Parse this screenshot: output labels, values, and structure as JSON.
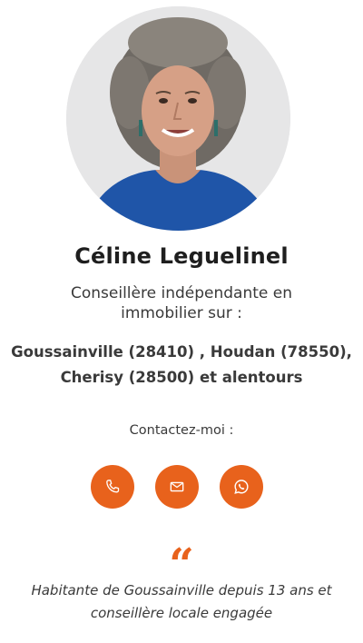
{
  "profile": {
    "name": "Céline Leguelinel",
    "role": "Conseillère indépendante en immobilier sur :",
    "areas_line1": "Goussainville (28410) , Houdan (78550),",
    "areas_line2": "Cherisy (28500) et alentours"
  },
  "contact": {
    "label": "Contactez-moi :",
    "buttons": [
      {
        "icon": "phone-icon"
      },
      {
        "icon": "mail-icon"
      },
      {
        "icon": "whatsapp-icon"
      }
    ],
    "accent_color": "#e8621c"
  },
  "quote": {
    "mark": "“",
    "line1": "Habitante de Goussainville depuis 13 ans et",
    "line2": "conseillère locale engagée"
  }
}
